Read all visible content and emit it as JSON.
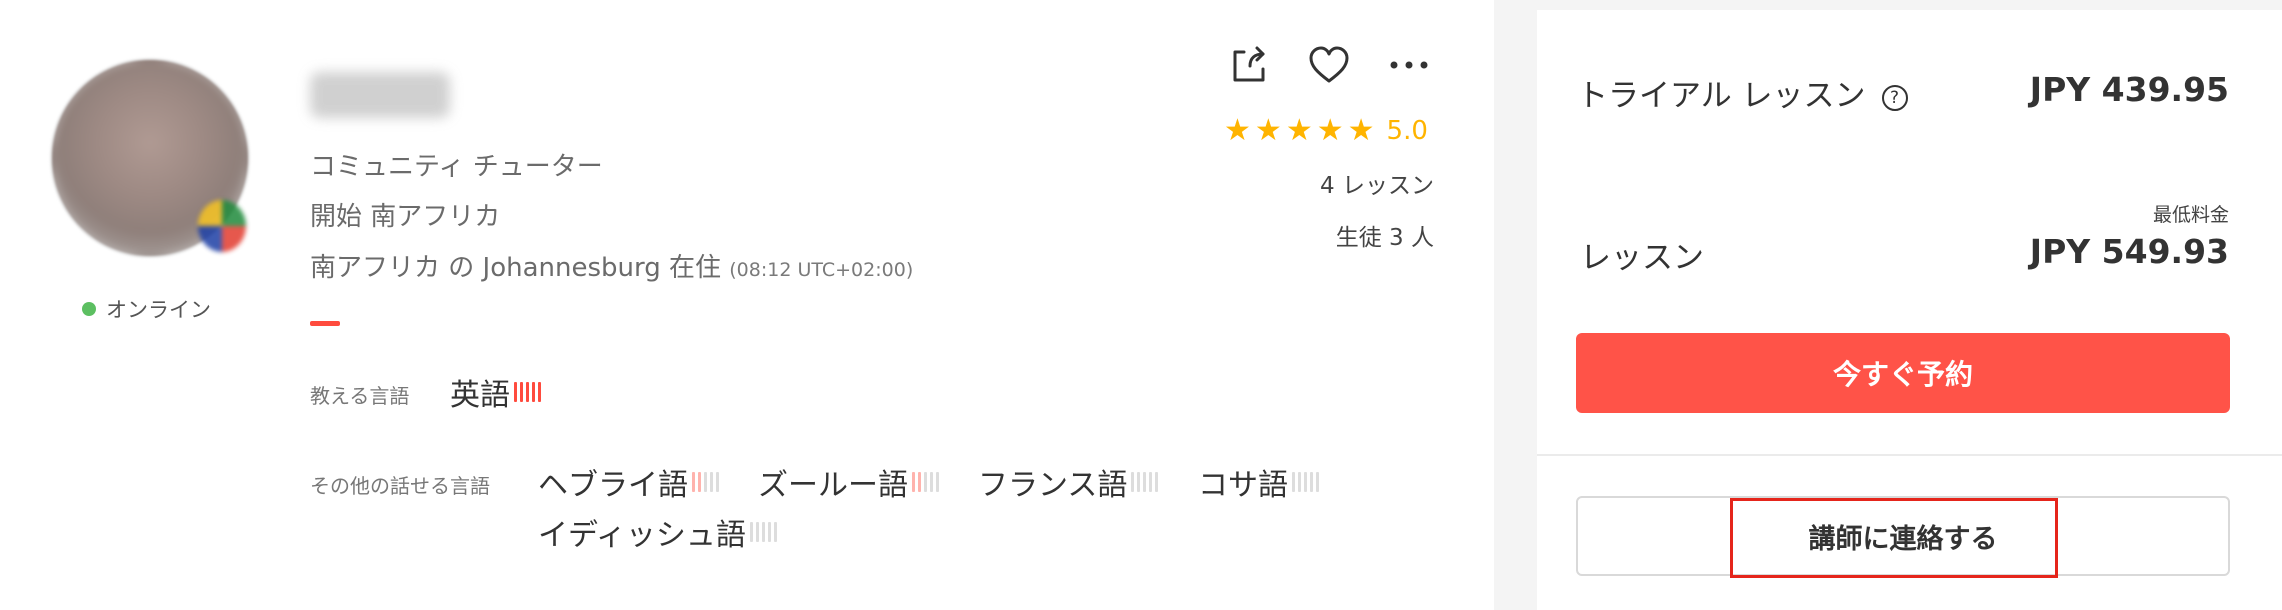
{
  "tutor": {
    "status": "オンライン",
    "role": "コミュニティ チューター",
    "origin": "開始 南アフリカ",
    "residence": "南アフリカ の Johannesburg 在住",
    "timezone": "(08:12 UTC+02:00)"
  },
  "teaches": {
    "label": "教える言語",
    "language": "英語",
    "level": 5
  },
  "other_languages": {
    "label": "その他の話せる言語",
    "items": [
      {
        "name": "ヘブライ語",
        "level": 2
      },
      {
        "name": "ズールー語",
        "level": 2
      },
      {
        "name": "フランス語",
        "level": 0
      },
      {
        "name": "コサ語",
        "level": 0
      },
      {
        "name": "イディッシュ語",
        "level": 0
      }
    ]
  },
  "actions": {
    "share_icon": "share-icon",
    "favorite_icon": "heart-icon",
    "more_icon": "more-icon"
  },
  "rating": {
    "stars": 5,
    "value": "5.0",
    "lessons": "4 レッスン",
    "students": "生徒 3 人"
  },
  "pricing": {
    "trial_label": "トライアル レッスン",
    "trial_price": "JPY 439.95",
    "min_label": "最低料金",
    "lesson_label": "レッスン",
    "lesson_price": "JPY 549.93",
    "book_button": "今すぐ予約",
    "contact_button": "講師に連絡する"
  },
  "colors": {
    "accent": "#ff5348",
    "star": "#ffb400",
    "online": "#5cbf61",
    "highlight": "#e5251b"
  }
}
